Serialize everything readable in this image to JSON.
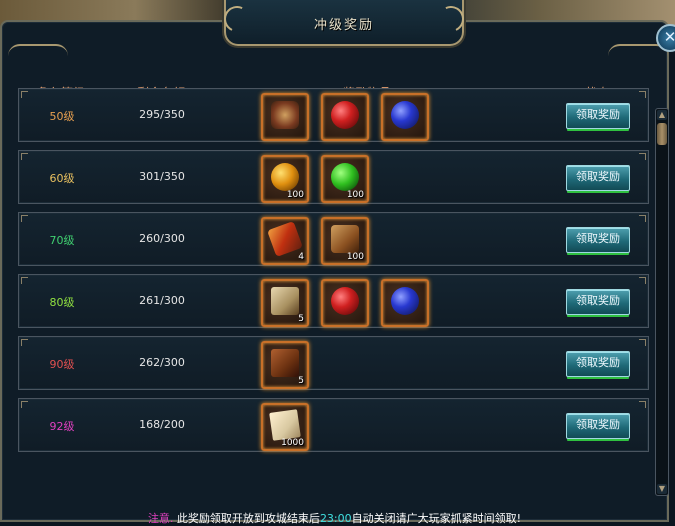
{
  "window": {
    "title": "冲级奖励",
    "close_glyph": "✕"
  },
  "header": {
    "level": "角色等级",
    "remaining": "剩余名额",
    "items": "奖励物品",
    "status": "状态"
  },
  "colors": {
    "level_50": "#e8a050",
    "level_60": "#e8c060",
    "level_70": "#40d070",
    "level_80": "#90e040",
    "level_90": "#e05050",
    "level_92": "#e040c0",
    "accent_orange": "#c87028",
    "button_teal": "#1f6a78"
  },
  "rows": [
    {
      "level": "50级",
      "remaining": "295/350",
      "button": "领取奖励",
      "items": [
        {
          "icon": "emblem",
          "qty": ""
        },
        {
          "icon": "red-orb",
          "qty": ""
        },
        {
          "icon": "blue-orb",
          "qty": ""
        }
      ]
    },
    {
      "level": "60级",
      "remaining": "301/350",
      "button": "领取奖励",
      "items": [
        {
          "icon": "gold-orb",
          "qty": "100"
        },
        {
          "icon": "green-orb",
          "qty": "100"
        }
      ]
    },
    {
      "level": "70级",
      "remaining": "260/300",
      "button": "领取奖励",
      "items": [
        {
          "icon": "scroll-red",
          "qty": "4"
        },
        {
          "icon": "box",
          "qty": "100"
        }
      ]
    },
    {
      "level": "80级",
      "remaining": "261/300",
      "button": "领取奖励",
      "items": [
        {
          "icon": "book",
          "qty": "5"
        },
        {
          "icon": "red-orb",
          "qty": ""
        },
        {
          "icon": "blue-orb",
          "qty": ""
        }
      ]
    },
    {
      "level": "90级",
      "remaining": "262/300",
      "button": "领取奖励",
      "items": [
        {
          "icon": "brown-book",
          "qty": "5"
        }
      ]
    },
    {
      "level": "92级",
      "remaining": "168/200",
      "button": "领取奖励",
      "items": [
        {
          "icon": "paper",
          "qty": "1000"
        }
      ]
    }
  ],
  "scrollbar": {
    "up": "▲",
    "down": "▼"
  },
  "notice": {
    "lead": "注意.",
    "text_before": " 此奖励领取开放到攻城结束后",
    "time": "23:00",
    "text_after": "自动关闭请广大玩家抓紧时间领取!"
  }
}
